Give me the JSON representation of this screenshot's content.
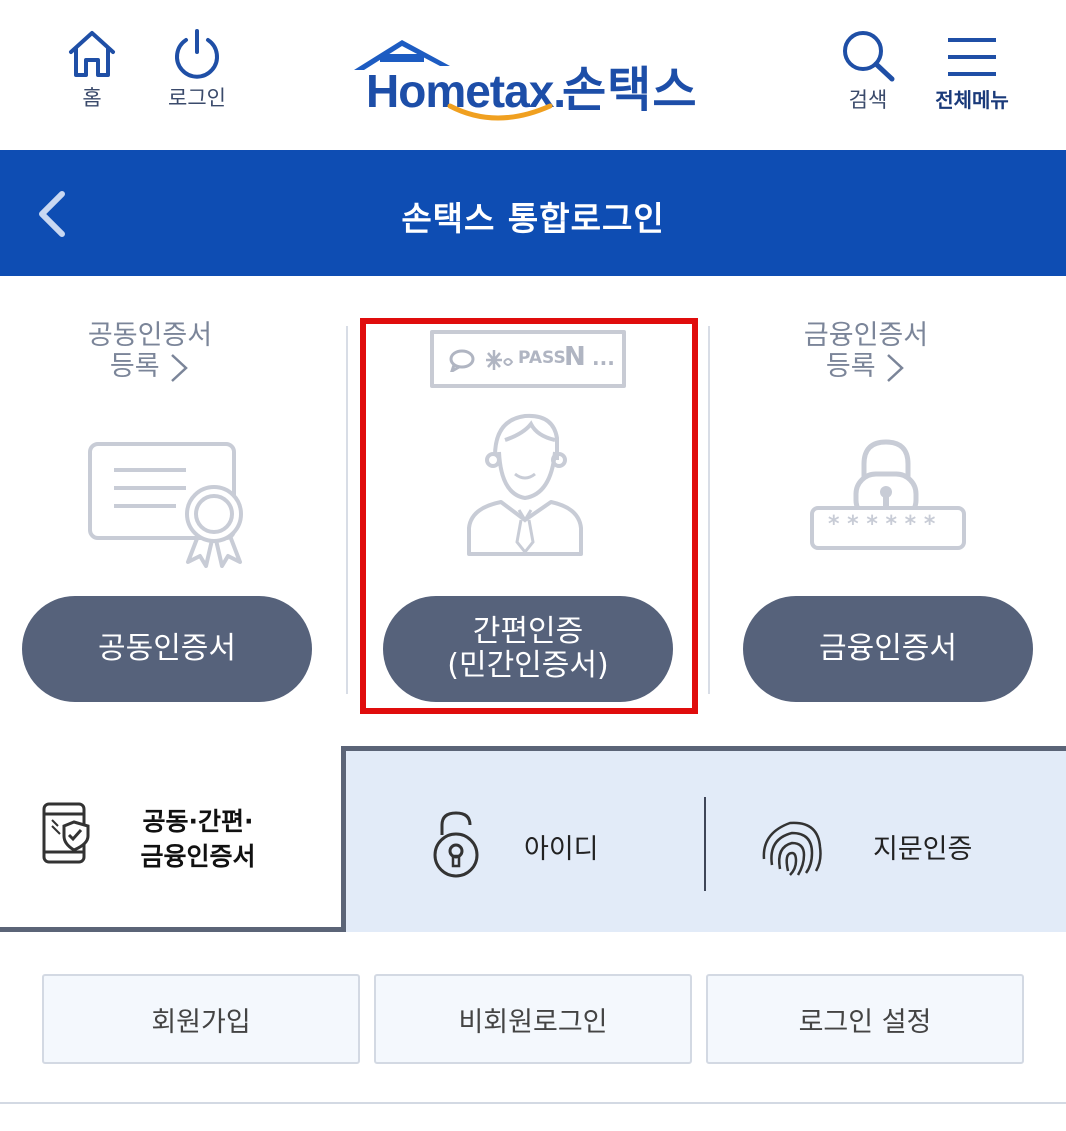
{
  "header": {
    "home_label": "홈",
    "login_label": "로그인",
    "logo_text": "Hometax.",
    "logo_korean": "손택스",
    "search_label": "검색",
    "menu_label": "전체메뉴"
  },
  "titlebar": {
    "title": "손택스 통합로그인"
  },
  "auth_options": {
    "joint_cert": {
      "register_line1": "공동인증서",
      "register_line2": "등록",
      "button_label": "공동인증서"
    },
    "simple_auth": {
      "badge_pass": "PASS",
      "badge_n": "N",
      "badge_more": "...",
      "button_line1": "간편인증",
      "button_line2": "(민간인증서)"
    },
    "financial_cert": {
      "register_line1": "금융인증서",
      "register_line2": "등록",
      "password_mask": "* * * * * *",
      "button_label": "금융인증서"
    }
  },
  "tabs": {
    "cert_tab_line1": "공동·간편·",
    "cert_tab_line2": "금융인증서",
    "id_tab": "아이디",
    "fingerprint_tab": "지문인증"
  },
  "bottom": {
    "join": "회원가입",
    "guest_login": "비회원로그인",
    "login_setting": "로그인 설정"
  },
  "colors": {
    "brand_blue": "#0e4db3",
    "button_gray": "#56627b",
    "highlight_red": "#e00d0d",
    "tab_bg": "#e2ebf8",
    "logo_orange": "#f0a020",
    "logo_green": "#3aa935"
  },
  "icons": {
    "home": "home-icon",
    "login": "power-icon",
    "search": "search-icon",
    "menu": "hamburger-menu-icon",
    "back": "chevron-left-icon",
    "certificate": "certificate-icon",
    "person": "person-icon",
    "padlock": "padlock-icon",
    "mobile_shield": "mobile-shield-icon",
    "lock": "lock-icon",
    "fingerprint": "fingerprint-icon"
  }
}
